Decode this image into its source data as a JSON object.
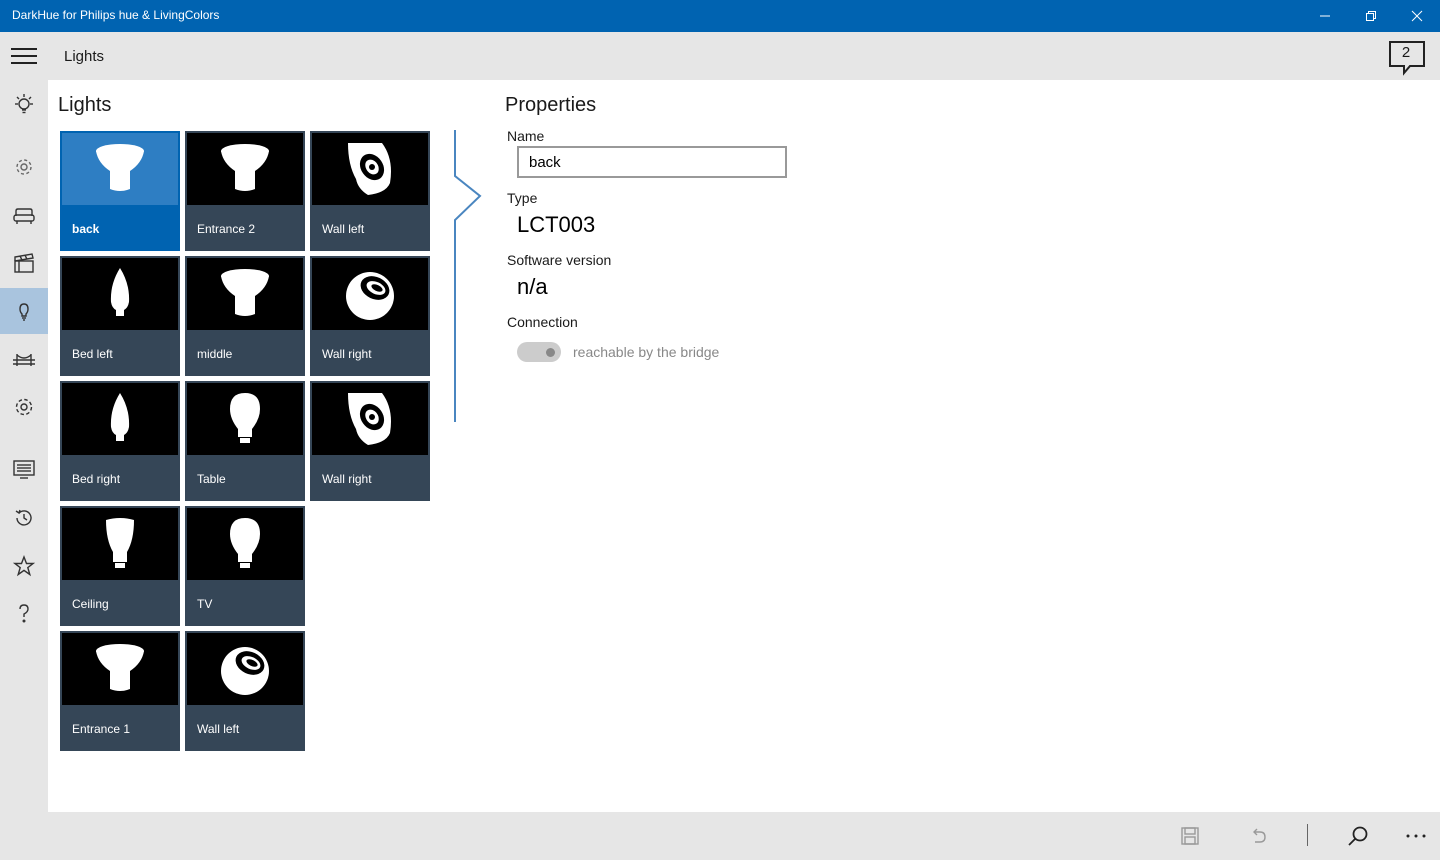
{
  "window": {
    "title": "DarkHue for Philips hue & LivingColors"
  },
  "header": {
    "page_title": "Lights",
    "notification_count": "2"
  },
  "nav": {
    "active": "lights-icon",
    "items": [
      "bulb-icon",
      "gear-small-icon",
      "sofa-icon",
      "clapperboard-icon",
      "lights-icon",
      "bridge-icon",
      "settings-icon",
      "list-icon",
      "history-icon",
      "star-icon",
      "help-icon"
    ]
  },
  "lights": {
    "title": "Lights",
    "items": [
      {
        "label": "back",
        "icon": "spot-bulb-icon",
        "selected": true
      },
      {
        "label": "Entrance 2",
        "icon": "spot-bulb-icon"
      },
      {
        "label": "Wall left",
        "icon": "livingcolors-wall-icon"
      },
      {
        "label": "Bed left",
        "icon": "candle-bulb-icon"
      },
      {
        "label": "middle",
        "icon": "spot-bulb-icon"
      },
      {
        "label": "Wall right",
        "icon": "livingcolors-iris-icon"
      },
      {
        "label": "Bed right",
        "icon": "candle-bulb-icon"
      },
      {
        "label": "Table",
        "icon": "classic-bulb-icon"
      },
      {
        "label": "Wall right",
        "icon": "livingcolors-wall-icon"
      },
      {
        "label": "Ceiling",
        "icon": "hue-bulb-icon"
      },
      {
        "label": "TV",
        "icon": "classic-bulb-icon"
      },
      {
        "label": "Entrance 1",
        "icon": "spot-bulb-icon"
      },
      {
        "label": "Wall left",
        "icon": "livingcolors-iris-icon"
      }
    ]
  },
  "properties": {
    "title": "Properties",
    "name_label": "Name",
    "name_value": "back",
    "type_label": "Type",
    "type_value": "LCT003",
    "software_label": "Software version",
    "software_value": "n/a",
    "connection_label": "Connection",
    "connection_text": "reachable by the bridge"
  },
  "bottombar": {
    "buttons": [
      "save-icon",
      "undo-icon",
      "search-icon",
      "more-icon"
    ]
  },
  "colors": {
    "accent": "#0063b1",
    "tile_bg": "#354657",
    "chrome": "#e6e6e6"
  }
}
